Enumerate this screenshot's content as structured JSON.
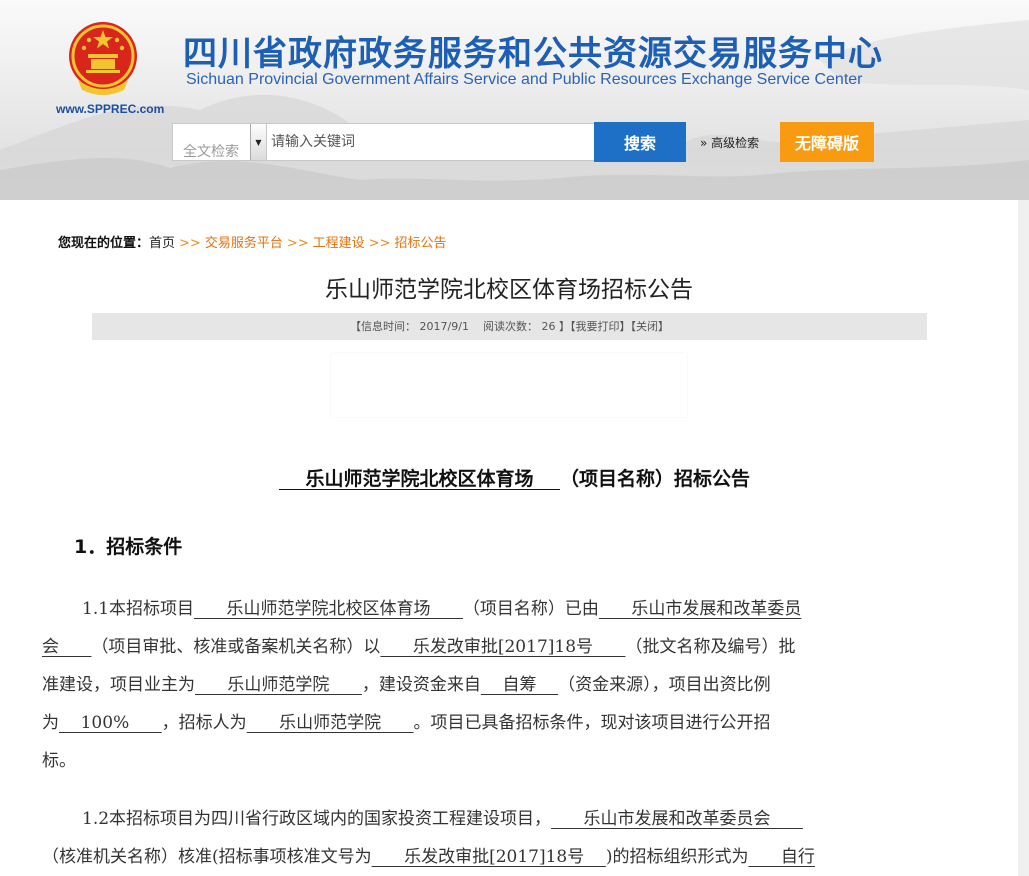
{
  "header": {
    "title_cn": "四川省政府政务服务和公共资源交易服务中心",
    "title_en": "Sichuan Provincial Government Affairs Service and Public Resources Exchange Service Center",
    "site_url": "www.SPPREC.com"
  },
  "search": {
    "type_label": "全文检索",
    "placeholder": "请输入关键词",
    "button_label": "搜索",
    "advanced_label": "高级检索",
    "advanced_prefix": "»",
    "accessibility_label": "无障碍版"
  },
  "breadcrumb": {
    "label": "您现在的位置：",
    "separator": ">>",
    "items": [
      "首页",
      "交易服务平台",
      "工程建设",
      "招标公告"
    ]
  },
  "article": {
    "title": "乐山师范学院北校区体育场招标公告",
    "meta": {
      "info_time_label": "【信息时间：",
      "info_time": "2017/9/1",
      "reads_label": "阅读次数：",
      "reads": "26",
      "close_bracket": "】",
      "print_label": "【我要打印】",
      "close_label": "【关闭】"
    }
  },
  "notice": {
    "heading_blank_left": "    ",
    "heading_project": "乐山师范学院北校区体育场",
    "heading_blank_right": "    ",
    "heading_suffix": "（项目名称）招标公告",
    "section1_title": "1．招标条件",
    "p1": {
      "l1_a": "1.1本招标项目",
      "l1_b": "      乐山师范学院北校区体育场      ",
      "l1_c": "（项目名称）已由",
      "l1_d": "      乐山市发展和改革委员",
      "l2_a": "会      ",
      "l2_b": "（项目审批、核准或备案机关名称）以",
      "l2_c": "      乐发改审批[2017]18号      ",
      "l2_d": "（批文名称及编号）批",
      "l3_a": "准建设，项目业主为",
      "l3_b": "      乐山师范学院      ",
      "l3_c": "，建设资金来自",
      "l3_d": "    自筹    ",
      "l3_e": "（资金来源），项目出资比例",
      "l4_a": "为",
      "l4_b": "    100%      ",
      "l4_c": "，招标人为",
      "l4_d": "      乐山师范学院      ",
      "l4_e": "。项目已具备招标条件，现对该项目进行公开招",
      "l5_a": "标。"
    },
    "p2": {
      "l1_a": "1.2本招标项目为四川省行政区域内的国家投资工程建设项目，",
      "l1_b": "      乐山市发展和改革委员会      ",
      "l2_a": "（核准机关名称）核准(招标事项核准文号为",
      "l2_b": "      乐发改审批[2017]18号    ",
      "l2_c": ")的招标组织形式为",
      "l2_d": "      自行"
    }
  },
  "colors": {
    "brand_blue": "#1c5fb4",
    "search_blue": "#1e6fc6",
    "accent_orange": "#f99b10",
    "breadcrumb_orange": "#e2730e"
  }
}
